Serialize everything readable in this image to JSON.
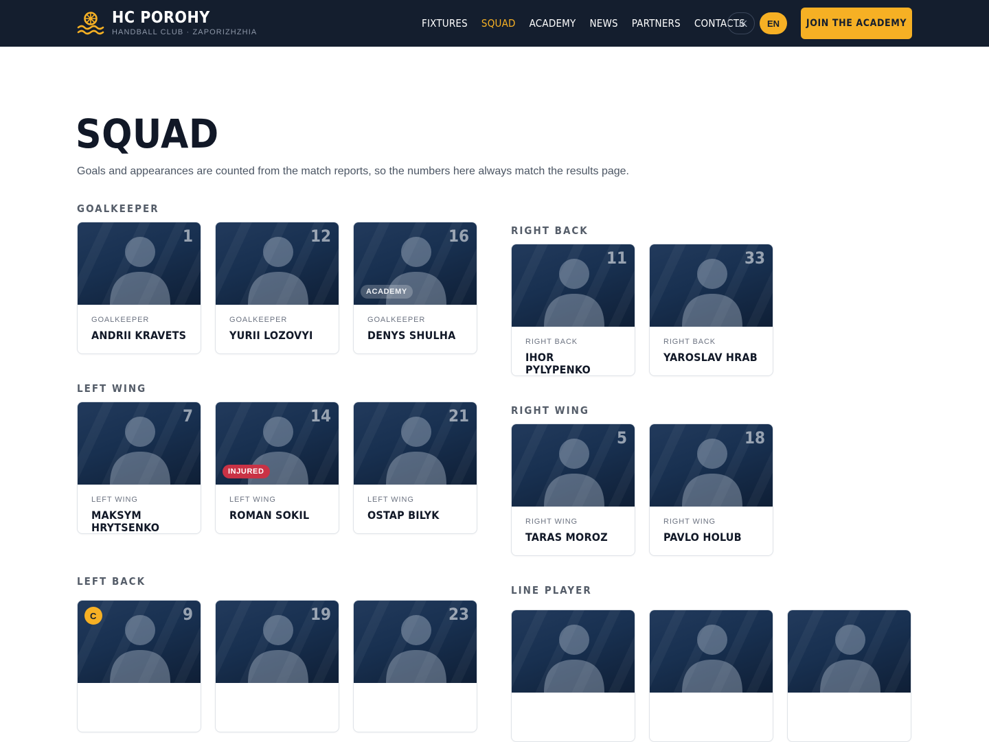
{
  "header": {
    "brand_name": "HC POROHY",
    "brand_sub": "HANDBALL CLUB · ZAPORIZHZHIA",
    "nav": [
      "FIXTURES",
      "SQUAD",
      "ACADEMY",
      "NEWS",
      "PARTNERS",
      "CONTACTS"
    ],
    "active_nav": "SQUAD",
    "lang_uk": "UK",
    "lang_en": "EN",
    "active_lang": "EN",
    "cta": "JOIN THE ACADEMY"
  },
  "page": {
    "title": "SQUAD",
    "description": "Goals and appearances are counted from the match reports, so the numbers here always match the results page."
  },
  "sections": {
    "goalkeeper": {
      "title": "GOALKEEPER",
      "players": [
        {
          "number": "1",
          "position": "GOALKEEPER",
          "name": "ANDRII KRAVETS"
        },
        {
          "number": "12",
          "position": "GOALKEEPER",
          "name": "YURII LOZOVYI"
        },
        {
          "number": "16",
          "position": "GOALKEEPER",
          "name": "DENYS SHULHA",
          "tag": "ACADEMY"
        }
      ]
    },
    "left_wing": {
      "title": "LEFT WING",
      "players": [
        {
          "number": "7",
          "position": "LEFT WING",
          "name": "MAKSYM HRYTSENKO"
        },
        {
          "number": "14",
          "position": "LEFT WING",
          "name": "ROMAN SOKIL",
          "tag": "INJURED"
        },
        {
          "number": "21",
          "position": "LEFT WING",
          "name": "OSTAP BILYK"
        }
      ]
    },
    "left_back": {
      "title": "LEFT BACK",
      "players": [
        {
          "number": "9",
          "captain": "C"
        },
        {
          "number": "19"
        },
        {
          "number": "23"
        }
      ]
    },
    "right_back": {
      "title": "RIGHT BACK",
      "players": [
        {
          "number": "11",
          "position": "RIGHT BACK",
          "name": "IHOR PYLYPENKO"
        },
        {
          "number": "33",
          "position": "RIGHT BACK",
          "name": "YAROSLAV HRAB"
        }
      ]
    },
    "right_wing": {
      "title": "RIGHT WING",
      "players": [
        {
          "number": "5",
          "position": "RIGHT WING",
          "name": "TARAS MOROZ"
        },
        {
          "number": "18",
          "position": "RIGHT WING",
          "name": "PAVLO HOLUB"
        }
      ]
    },
    "line_player": {
      "title": "LINE PLAYER",
      "players": [
        {},
        {},
        {}
      ]
    }
  },
  "colors": {
    "header_bg": "#141e2e",
    "accent": "#f6b024",
    "injured": "#c93245"
  }
}
